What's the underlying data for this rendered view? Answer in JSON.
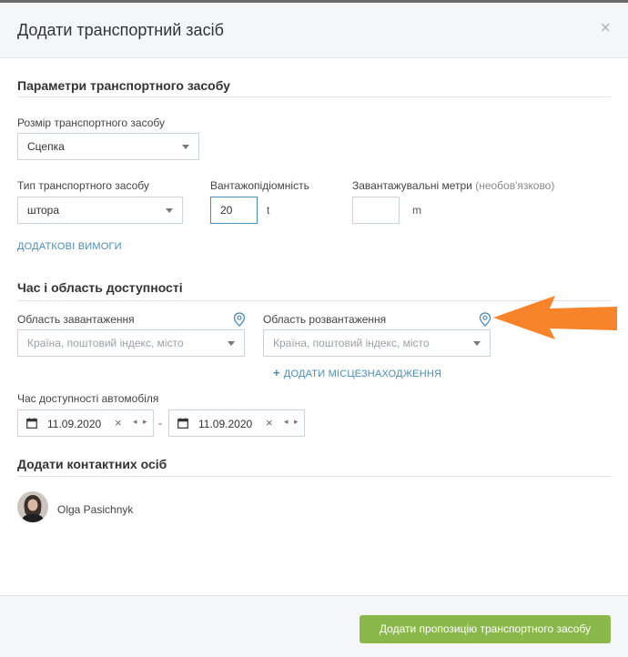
{
  "modal": {
    "title": "Додати транспортний засіб",
    "close_glyph": "×"
  },
  "params": {
    "section_title": "Параметри транспортного засобу",
    "size_label": "Розмір транспортного засобу",
    "size_value": "Сцепка",
    "type_label": "Тип транспортного засобу",
    "type_value": "штора",
    "capacity_label": "Вантажопідіомність",
    "capacity_value": "20",
    "capacity_unit": "t",
    "loading_meters_label": "Завантажувальні метри",
    "loading_meters_optional": "(необов'язково)",
    "loading_meters_value": "",
    "loading_meters_unit": "m",
    "extra_requirements_link": "ДОДАТКОВІ ВИМОГИ"
  },
  "availability": {
    "section_title": "Час і область доступності",
    "loading_area_label": "Область завантаження",
    "loading_area_placeholder": "Країна, поштовий індекс, місто",
    "unloading_area_label": "Область розвантаження",
    "unloading_area_placeholder": "Країна, поштовий індекс, місто",
    "add_location_link": "ДОДАТИ МІСЦЕЗНАХОДЖЕННЯ",
    "add_location_plus": "+",
    "time_label": "Час доступності автомобіля",
    "date_from": "11.09.2020",
    "date_to": "11.09.2020",
    "date_separator": "-",
    "clear_glyph": "×",
    "stepper_glyph": "◂ ▸"
  },
  "contacts": {
    "section_title": "Додати контактних осіб",
    "person_name": "Olga Pasichnyk"
  },
  "footer": {
    "submit_label": "Додати пропозицію транспортного засобу"
  },
  "colors": {
    "accent_link": "#4a8cb5",
    "submit_green": "#8bb84a",
    "annotation_arrow": "#f7842b"
  },
  "icons": [
    "close-icon",
    "location-pin-icon",
    "calendar-icon",
    "clear-icon",
    "chevron-left-right-icon",
    "plus-icon",
    "annotation-arrow"
  ]
}
